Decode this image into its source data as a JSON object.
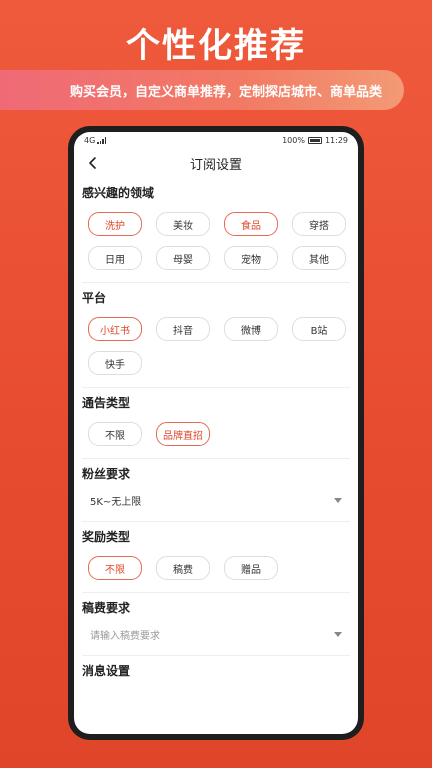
{
  "hero": {
    "title": "个性化推荐",
    "banner": "购买会员，自定义商单推荐，定制探店城市、商单品类"
  },
  "status": {
    "network": "4G",
    "battery": "100%",
    "time": "11:29"
  },
  "nav": {
    "title": "订阅设置"
  },
  "sections": {
    "interest": {
      "title": "感兴趣的领域",
      "options": [
        {
          "label": "洗护",
          "selected": true
        },
        {
          "label": "美妆",
          "selected": false
        },
        {
          "label": "食品",
          "selected": true
        },
        {
          "label": "穿搭",
          "selected": false
        },
        {
          "label": "日用",
          "selected": false
        },
        {
          "label": "母婴",
          "selected": false
        },
        {
          "label": "宠物",
          "selected": false
        },
        {
          "label": "其他",
          "selected": false
        }
      ]
    },
    "platform": {
      "title": "平台",
      "options": [
        {
          "label": "小红书",
          "selected": true
        },
        {
          "label": "抖音",
          "selected": false
        },
        {
          "label": "微博",
          "selected": false
        },
        {
          "label": "B站",
          "selected": false
        },
        {
          "label": "快手",
          "selected": false
        }
      ]
    },
    "notice_type": {
      "title": "通告类型",
      "options": [
        {
          "label": "不限",
          "selected": false
        },
        {
          "label": "品牌直招",
          "selected": true
        }
      ]
    },
    "fans": {
      "title": "粉丝要求",
      "value": "5K~无上限"
    },
    "reward": {
      "title": "奖励类型",
      "options": [
        {
          "label": "不限",
          "selected": true
        },
        {
          "label": "稿费",
          "selected": false
        },
        {
          "label": "赠品",
          "selected": false
        }
      ]
    },
    "fee": {
      "title": "稿费要求",
      "placeholder": "请输入稿费要求"
    },
    "message": {
      "title": "消息设置"
    }
  }
}
